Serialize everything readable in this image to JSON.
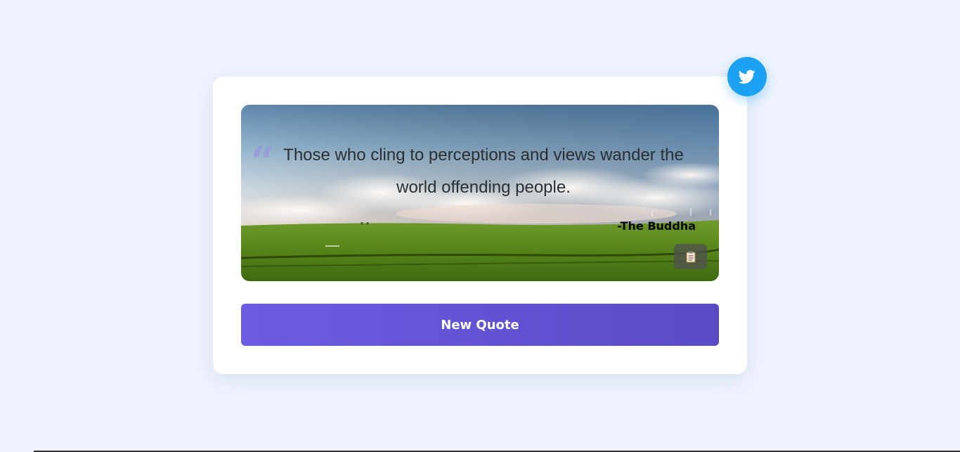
{
  "quote": {
    "text": "Those who cling to perceptions and views wander the world offending people.",
    "author": "-The Buddha",
    "quote_mark": "“"
  },
  "actions": {
    "new_quote_label": "New Quote"
  },
  "icons": {
    "twitter": "twitter-bird-icon",
    "copy": "clipboard-icon"
  },
  "colors": {
    "background": "#eef3fd",
    "card": "#ffffff",
    "twitter": "#1da1f2",
    "button_start": "#6c5ce3",
    "button_end": "#5a4bc5"
  }
}
